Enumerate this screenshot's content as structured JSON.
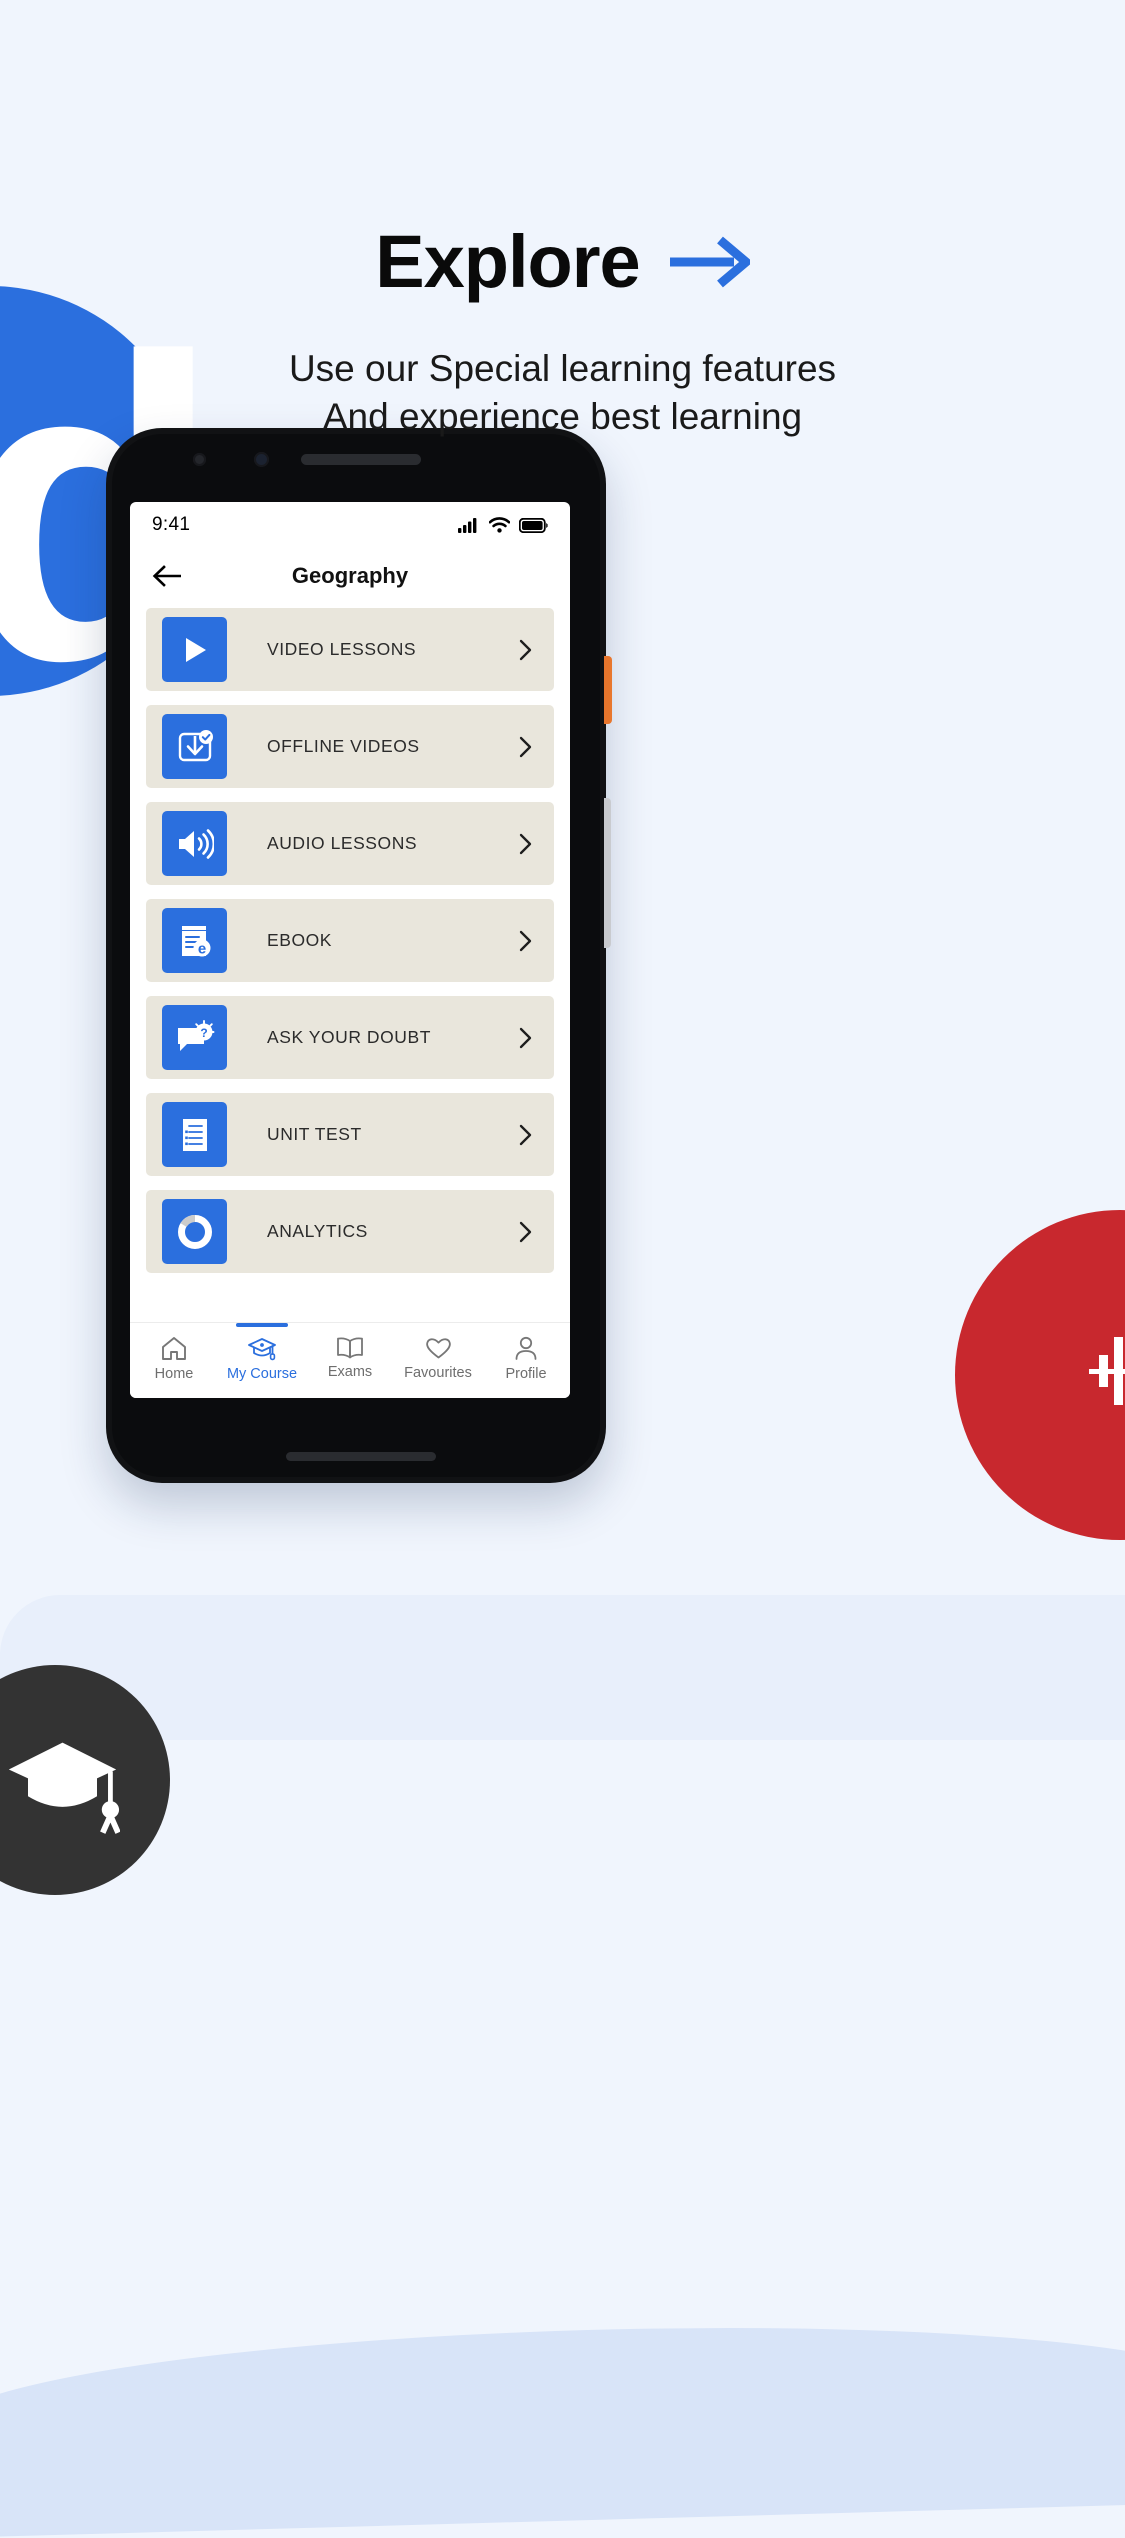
{
  "page": {
    "background_color": "#F0F5FD",
    "accent_blue": "#2B6FDE",
    "accent_red": "#C8282E",
    "dark": "#333333",
    "row_bg": "#E9E6DC"
  },
  "hero": {
    "title": "Explore",
    "arrow_icon": "arrow-right-icon",
    "subtitle_line1": "Use our Special learning features",
    "subtitle_line2": "And experience best learning"
  },
  "decorations": {
    "brand_letter": "d",
    "blue_circle_icon": "blue-circle-shape",
    "red_circle_icon": "red-circle-shape",
    "equalizer_icon": "equalizer-icon",
    "graduation_cap_icon": "graduation-cap-icon"
  },
  "phone": {
    "statusbar": {
      "time": "9:41",
      "signal_icon": "cellular-signal-icon",
      "wifi_icon": "wifi-icon",
      "battery_icon": "battery-full-icon"
    },
    "header": {
      "back_icon": "arrow-left-icon",
      "title": "Geography"
    },
    "list": [
      {
        "label": "VIDEO LESSONS",
        "icon": "play-icon",
        "chevron": "chevron-right-icon"
      },
      {
        "label": "OFFLINE VIDEOS",
        "icon": "download-check-icon",
        "chevron": "chevron-right-icon"
      },
      {
        "label": "AUDIO LESSONS",
        "icon": "speaker-volume-icon",
        "chevron": "chevron-right-icon"
      },
      {
        "label": "EBOOK",
        "icon": "ebook-icon",
        "chevron": "chevron-right-icon"
      },
      {
        "label": "ASK YOUR DOUBT",
        "icon": "chat-question-icon",
        "chevron": "chevron-right-icon"
      },
      {
        "label": "UNIT TEST",
        "icon": "document-list-icon",
        "chevron": "chevron-right-icon"
      },
      {
        "label": "ANALYTICS",
        "icon": "donut-chart-icon",
        "chevron": "chevron-right-icon"
      }
    ],
    "bottomnav": [
      {
        "label": "Home",
        "icon": "home-icon",
        "active": false
      },
      {
        "label": "My Course",
        "icon": "graduation-cap-icon",
        "active": true
      },
      {
        "label": "Exams",
        "icon": "open-book-icon",
        "active": false
      },
      {
        "label": "Favourites",
        "icon": "heart-icon",
        "active": false
      },
      {
        "label": "Profile",
        "icon": "person-icon",
        "active": false
      }
    ]
  }
}
